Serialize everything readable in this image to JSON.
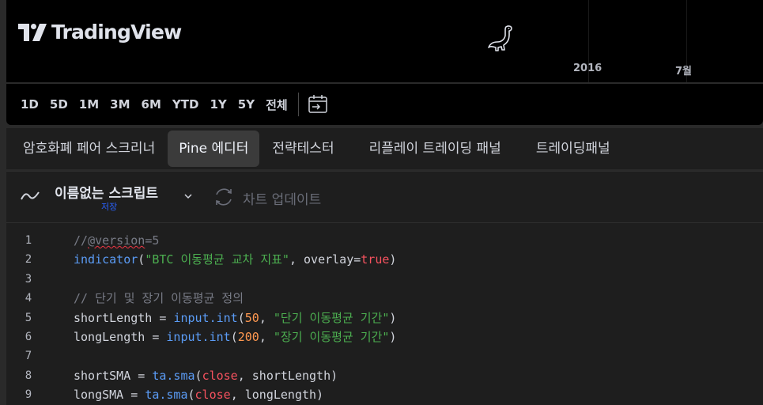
{
  "chart": {
    "brand": "TradingView",
    "x_labels": [
      "2016",
      "7월"
    ]
  },
  "range_bar": {
    "buttons": [
      "1D",
      "5D",
      "1M",
      "3M",
      "6M",
      "YTD",
      "1Y",
      "5Y",
      "전체"
    ]
  },
  "panel_tabs": [
    "암호화폐 페어 스크리너",
    "Pine 에디터",
    "전략테스터",
    "리플레이 트레이딩 패널",
    "트레이딩패널"
  ],
  "editor": {
    "script_name": "이름없는 스크립트",
    "save_label": "저장",
    "update_label": "차트 업데이트"
  },
  "code_lines": [
    {
      "n": "1",
      "parts": [
        {
          "t": "//",
          "c": "cm"
        },
        {
          "t": "@version",
          "c": "cm squig"
        },
        {
          "t": "=5",
          "c": "cm"
        }
      ]
    },
    {
      "n": "2",
      "parts": [
        {
          "t": "indicator",
          "c": "fn"
        },
        {
          "t": "(",
          "c": "op"
        },
        {
          "t": "\"BTC 이동평균 교차 지표\"",
          "c": "str"
        },
        {
          "t": ", overlay",
          "c": "op"
        },
        {
          "t": "=",
          "c": "op"
        },
        {
          "t": "true",
          "c": "kw"
        },
        {
          "t": ")",
          "c": "op"
        }
      ]
    },
    {
      "n": "3",
      "parts": []
    },
    {
      "n": "4",
      "parts": [
        {
          "t": "// 단기 및 장기 이동평균 정의",
          "c": "cm"
        }
      ]
    },
    {
      "n": "5",
      "parts": [
        {
          "t": "shortLength ",
          "c": "op"
        },
        {
          "t": "= ",
          "c": "op"
        },
        {
          "t": "input.int",
          "c": "fn"
        },
        {
          "t": "(",
          "c": "op"
        },
        {
          "t": "50",
          "c": "num"
        },
        {
          "t": ", ",
          "c": "op"
        },
        {
          "t": "\"단기 이동평균 기간\"",
          "c": "str"
        },
        {
          "t": ")",
          "c": "op"
        }
      ]
    },
    {
      "n": "6",
      "parts": [
        {
          "t": "longLength ",
          "c": "op"
        },
        {
          "t": "= ",
          "c": "op"
        },
        {
          "t": "input.int",
          "c": "fn"
        },
        {
          "t": "(",
          "c": "op"
        },
        {
          "t": "200",
          "c": "num"
        },
        {
          "t": ", ",
          "c": "op"
        },
        {
          "t": "\"장기 이동평균 기간\"",
          "c": "str"
        },
        {
          "t": ")",
          "c": "op"
        }
      ]
    },
    {
      "n": "7",
      "parts": []
    },
    {
      "n": "8",
      "parts": [
        {
          "t": "shortSMA ",
          "c": "op"
        },
        {
          "t": "= ",
          "c": "op"
        },
        {
          "t": "ta.sma",
          "c": "fn"
        },
        {
          "t": "(",
          "c": "op"
        },
        {
          "t": "close",
          "c": "kw"
        },
        {
          "t": ", shortLength)",
          "c": "op"
        }
      ]
    },
    {
      "n": "9",
      "parts": [
        {
          "t": "longSMA ",
          "c": "op"
        },
        {
          "t": "= ",
          "c": "op"
        },
        {
          "t": "ta.sma",
          "c": "fn"
        },
        {
          "t": "(",
          "c": "op"
        },
        {
          "t": "close",
          "c": "kw"
        },
        {
          "t": ", longLength)",
          "c": "op"
        }
      ]
    }
  ],
  "icons": {
    "logo": "tradingview-logo-icon",
    "dino": "dinosaur-icon",
    "calendar": "calendar-goto-date-icon",
    "wave": "indicator-wave-icon",
    "chevron": "chevron-down-icon",
    "update": "refresh-icon"
  },
  "colors": {
    "accent": "#2962ff",
    "string": "#4caf50",
    "keyword": "#f7525f",
    "number": "#ff9850",
    "function": "#5b9cf6",
    "comment": "#787b86"
  }
}
